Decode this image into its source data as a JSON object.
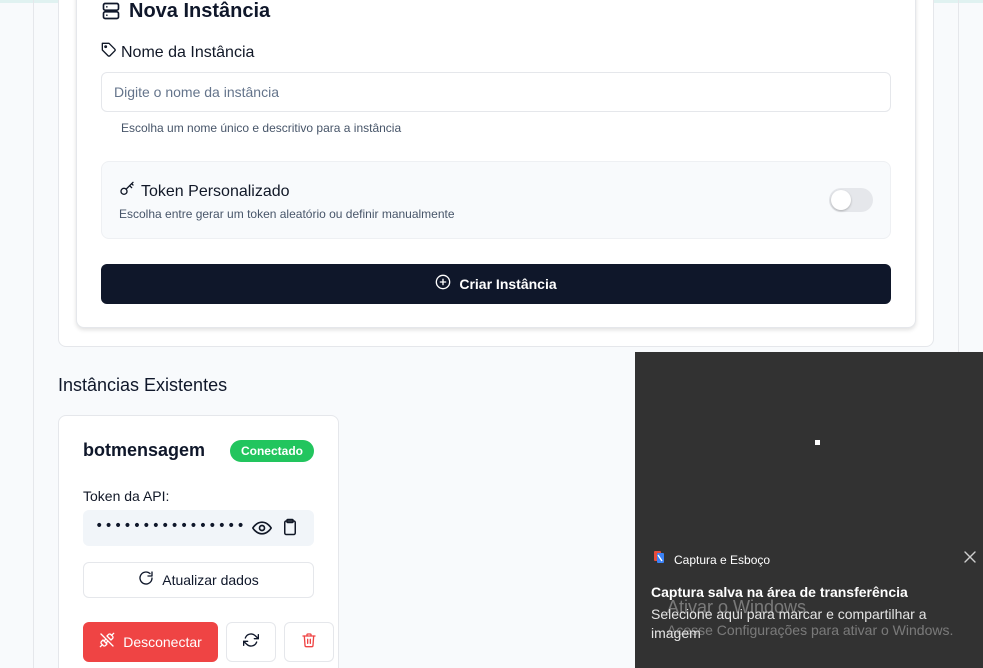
{
  "form": {
    "title": "Nova Instância",
    "name_label": "Nome da Instância",
    "name_input": {
      "value": "",
      "placeholder": "Digite o nome da instância"
    },
    "name_help": "Escolha um nome único e descritivo para a instância",
    "token_toggle": {
      "label": "Token Personalizado",
      "description": "Escolha entre gerar um token aleatório ou definir manualmente",
      "enabled": false
    },
    "submit_label": "Criar Instância"
  },
  "existing": {
    "title": "Instâncias Existentes",
    "instances": [
      {
        "name": "botmensagem",
        "status": "Conectado",
        "status_color": "#22c55e",
        "token_label": "Token da API:",
        "token_masked": "••••••••••••••••",
        "update_label": "Atualizar dados",
        "disconnect_label": "Desconectar"
      }
    ]
  },
  "notification": {
    "app_name": "Captura e Esboço",
    "heading": "Captura salva na área de transferência",
    "body": "Selecione aqui para marcar e compartilhar a imagem"
  },
  "watermark": {
    "title": "Ativar o Windows",
    "subtitle": "Acesse Configurações para ativar o Windows."
  },
  "colors": {
    "primary": "#0f172a",
    "success": "#22c55e",
    "danger": "#ef4444",
    "toast_bg": "#323232"
  },
  "icons": [
    "server-icon",
    "tag-icon",
    "key-icon",
    "plus-circle-icon",
    "eye-icon",
    "clipboard-icon",
    "refresh-icon",
    "unplug-icon",
    "restart-icon",
    "trash-icon",
    "close-icon",
    "snip-app-icon"
  ]
}
